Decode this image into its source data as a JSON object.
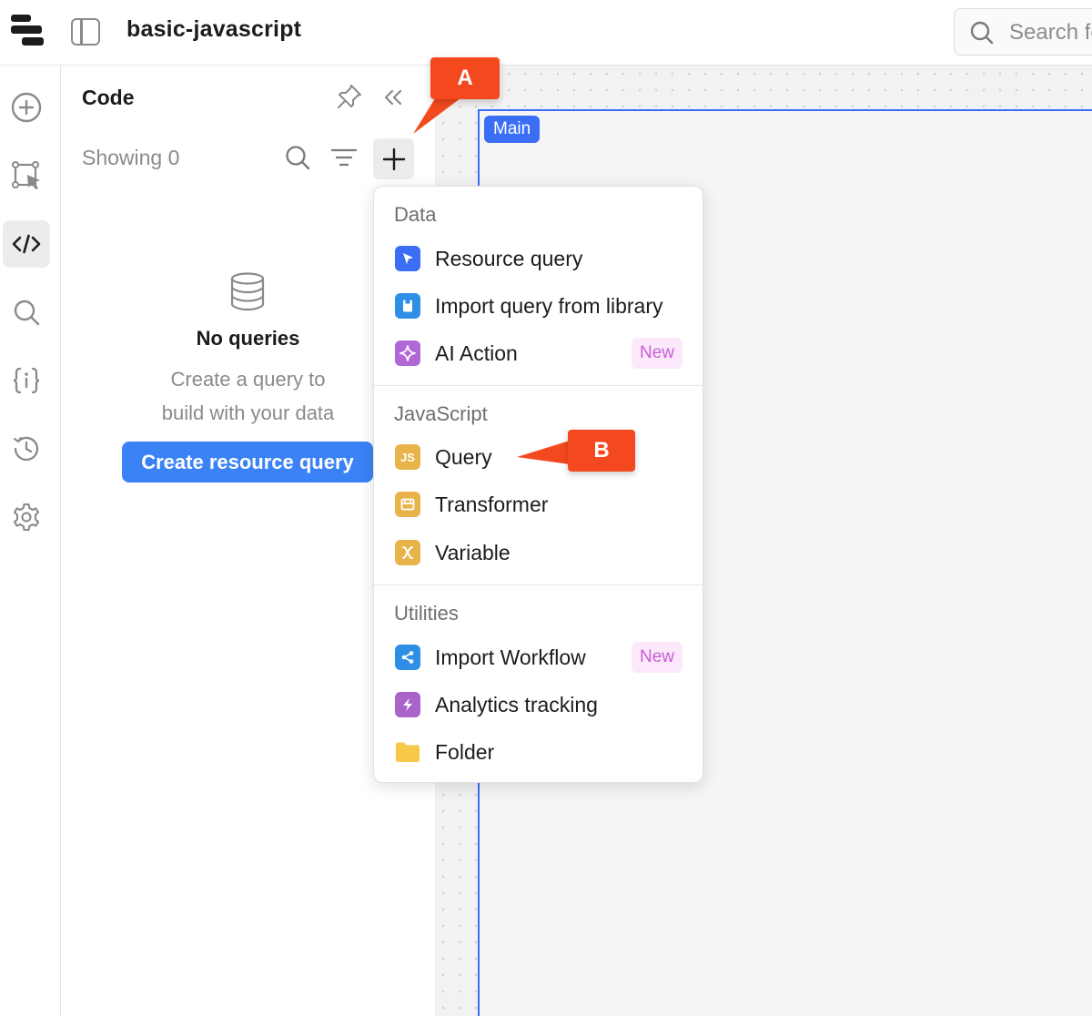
{
  "app": {
    "title": "basic-javascript",
    "search_placeholder": "Search fo"
  },
  "rail": {
    "items": [
      {
        "icon": "add-circle-icon"
      },
      {
        "icon": "select-component-icon"
      },
      {
        "icon": "code-icon",
        "active": true
      },
      {
        "icon": "search-icon"
      },
      {
        "icon": "state-icon"
      },
      {
        "icon": "history-icon"
      },
      {
        "icon": "settings-icon"
      }
    ]
  },
  "code_panel": {
    "title": "Code",
    "showing_label": "Showing 0",
    "empty_title": "No queries",
    "empty_desc_line1": "Create a query to",
    "empty_desc_line2": "build with your data",
    "create_button": "Create resource query"
  },
  "canvas": {
    "frame_label": "Main"
  },
  "menu": {
    "sections": [
      {
        "header": "Data",
        "items": [
          {
            "label": "Resource query",
            "icon": "resource-query-icon",
            "icon_color": "#3b6ef5"
          },
          {
            "label": "Import query from library",
            "icon": "library-icon",
            "icon_color": "#2f8fe6"
          },
          {
            "label": "AI Action",
            "icon": "ai-sparkle-icon",
            "icon_color": "#b267d6",
            "badge": "New"
          }
        ]
      },
      {
        "header": "JavaScript",
        "items": [
          {
            "label": "Query",
            "icon": "js-icon",
            "icon_color": "#e8b34a",
            "icon_text": "JS"
          },
          {
            "label": "Transformer",
            "icon": "transformer-icon",
            "icon_color": "#e8b34a"
          },
          {
            "label": "Variable",
            "icon": "variable-icon",
            "icon_color": "#e8b34a"
          }
        ]
      },
      {
        "header": "Utilities",
        "items": [
          {
            "label": "Import Workflow",
            "icon": "workflow-icon",
            "icon_color": "#2f8fe6",
            "badge": "New"
          },
          {
            "label": "Analytics tracking",
            "icon": "analytics-icon",
            "icon_color": "#a963c9"
          },
          {
            "label": "Folder",
            "icon": "folder-icon",
            "icon_color": "#f7c948"
          }
        ]
      }
    ]
  },
  "annotations": {
    "callout_a": "A",
    "callout_b": "B"
  }
}
